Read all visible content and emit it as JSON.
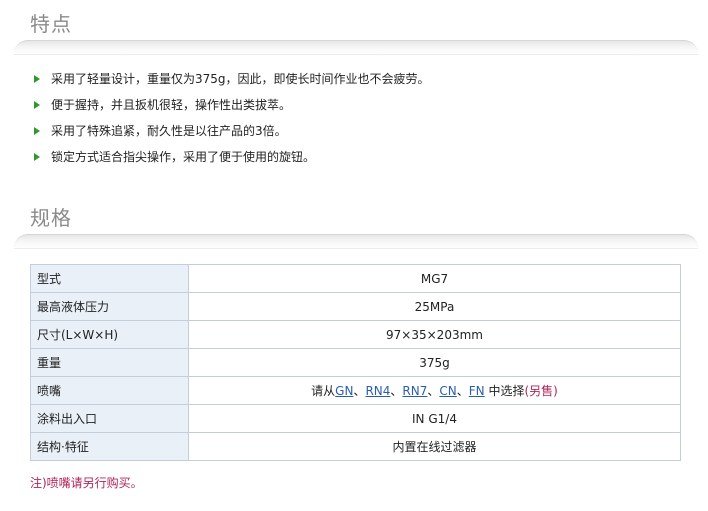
{
  "features": {
    "title": "特点",
    "items": [
      "采用了轻量设计，重量仅为375g，因此，即使长时间作业也不会疲劳。",
      "便于握持，并且扳机很轻，操作性出类拔萃。",
      "采用了特殊追紧，耐久性是以往产品的3倍。",
      "锁定方式适合指尖操作，采用了便于使用的旋钮。"
    ]
  },
  "specs": {
    "title": "规格",
    "rows": [
      {
        "label": "型式",
        "value": "MG7"
      },
      {
        "label": "最高液体压力",
        "value": "25MPa"
      },
      {
        "label": "尺寸(L×W×H)",
        "value": "97×35×203mm"
      },
      {
        "label": "重量",
        "value": "375g"
      },
      {
        "label": "喷嘴"
      },
      {
        "label": "涂料出入口",
        "value": "IN G1/4"
      },
      {
        "label": "结构·特征",
        "value": "内置在线过滤器"
      }
    ],
    "nozzle": {
      "prefix": "请从",
      "links": [
        "GN",
        "RN4",
        "RN7",
        "CN",
        "FN"
      ],
      "separator": "、",
      "suffix": " 中选择",
      "note": "(另售)"
    }
  },
  "footnote": "注)喷嘴请另行购买。",
  "colors": {
    "bullet": "#2e9a2e",
    "link": "#2a5db0",
    "note": "#b0245a",
    "label_bg": "#eaf0f8"
  }
}
